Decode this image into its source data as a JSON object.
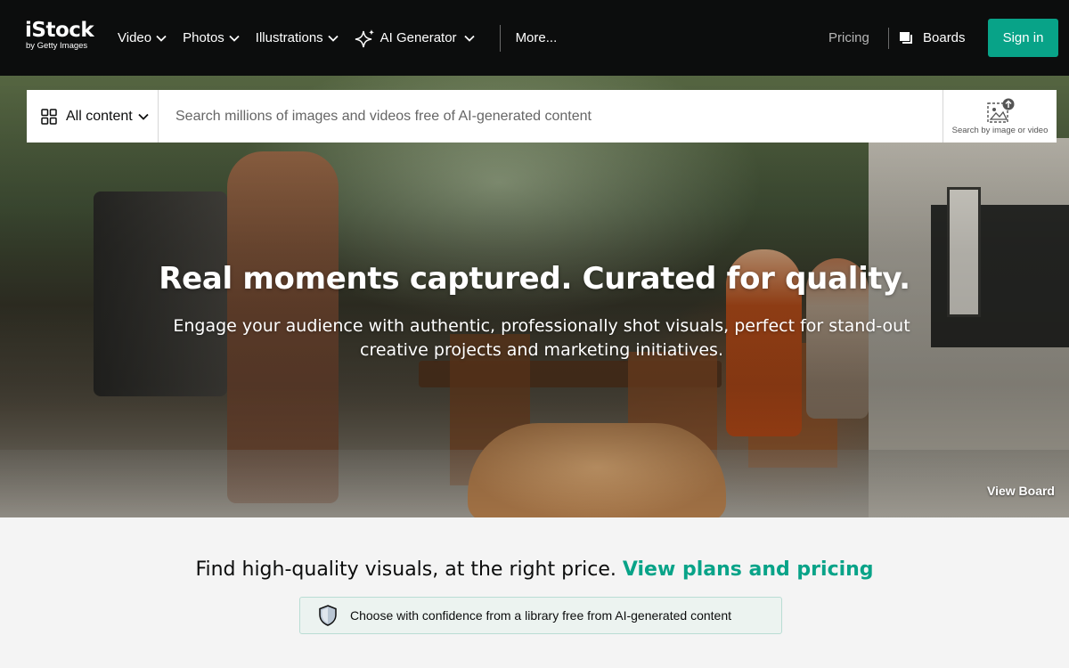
{
  "brand": {
    "logo_main": "iStock",
    "logo_sub": "by Getty Images"
  },
  "nav": {
    "items": [
      {
        "label": "Video"
      },
      {
        "label": "Photos"
      },
      {
        "label": "Illustrations"
      },
      {
        "label": "AI Generator"
      }
    ],
    "more": "More...",
    "pricing": "Pricing",
    "boards": "Boards",
    "sign_in": "Sign in"
  },
  "search": {
    "content_type": "All content",
    "placeholder": "Search millions of images and videos free of AI-generated content",
    "image_search_label": "Search by image or video"
  },
  "hero": {
    "title": "Real moments captured. Curated for quality.",
    "subtitle": "Engage your audience with authentic, professionally shot visuals, perfect for stand-out creative projects and marketing initiatives.",
    "view_board": "View Board"
  },
  "pricing_section": {
    "text": "Find high-quality visuals, at the right price.",
    "link": "View plans and pricing"
  },
  "ai_notice": {
    "text": "Choose with confidence from a library free from AI-generated content"
  },
  "colors": {
    "accent": "#08a388",
    "nav_bg": "#0c0d0d",
    "page_bg": "#f4f4f4"
  }
}
